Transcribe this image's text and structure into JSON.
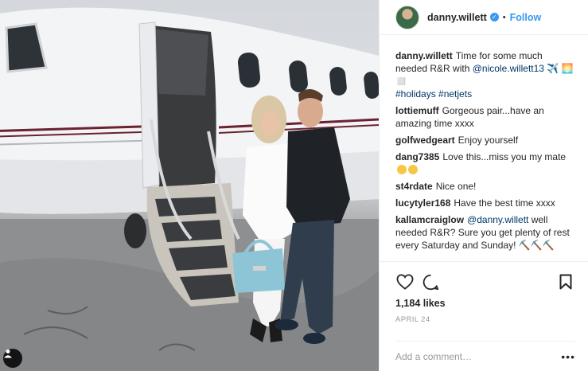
{
  "post": {
    "author": "danny.willett",
    "follow_label": "Follow",
    "separator": "•",
    "caption": {
      "author": "danny.willett",
      "text_before": "Time for some much needed R&R with ",
      "mention": "@nicole.willett13",
      "text_after": " ✈️ 🌅◻️",
      "hashtags": "#holidays #netjets"
    },
    "comments": [
      {
        "author": "lottiemuff",
        "text": "Gorgeous pair...have an amazing time xxxx"
      },
      {
        "author": "golfwedgeart",
        "text": "Enjoy yourself"
      },
      {
        "author": "dang7385",
        "text": "Love this...miss you my mate"
      },
      {
        "author": "st4rdate",
        "text": "Nice one!"
      },
      {
        "author": "lucytyler168",
        "text": "Have the best time xxxx"
      },
      {
        "author": "kallamcraiglow",
        "mention": "@danny.willett",
        "text": " well needed R&R? Sure you get plenty of rest every Saturday and Sunday! ⛏️⛏️⛏️"
      }
    ],
    "likes": "1,184 likes",
    "date": "April 24",
    "add_comment_placeholder": "Add a comment…",
    "more_label": "•••"
  },
  "icons": {
    "like": "heart-icon",
    "comment": "comment-bubble-icon",
    "save": "bookmark-icon",
    "verified": "verified-badge-icon",
    "user_tag": "user-tag-icon"
  },
  "colors": {
    "link_blue": "#3897f0",
    "mention_blue": "#003569",
    "text": "#262626",
    "muted": "#999999",
    "border": "#efefef"
  }
}
